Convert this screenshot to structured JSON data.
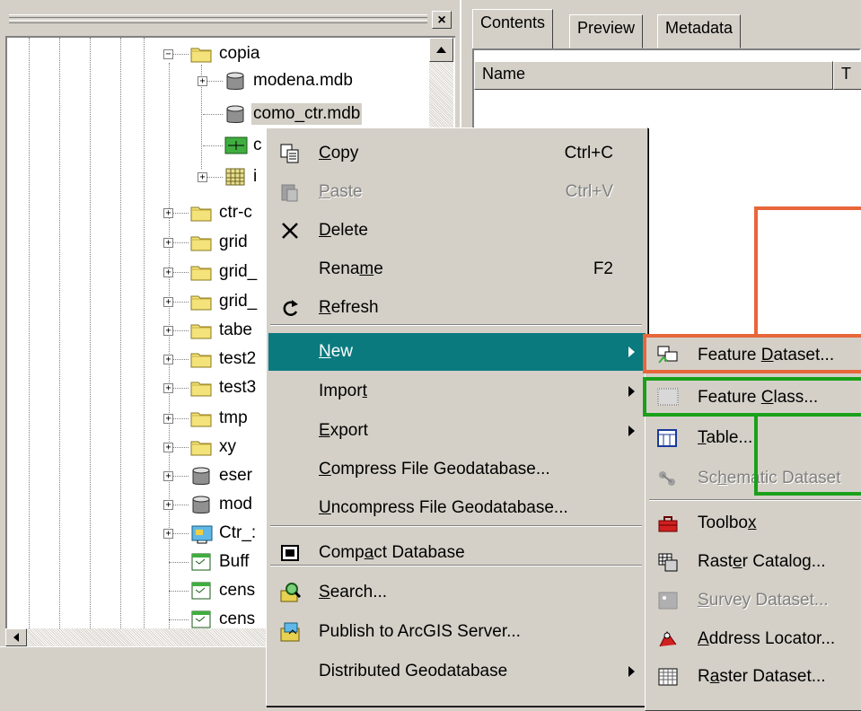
{
  "tree": {
    "items": [
      {
        "label": "copia",
        "icon": "folder-icon",
        "expander": "−"
      },
      {
        "label": "modena.mdb",
        "icon": "database-icon",
        "expander": "+"
      },
      {
        "label": "como_ctr.mdb",
        "icon": "database-icon",
        "expander": ""
      },
      {
        "label": "c",
        "icon": "feature-class-icon",
        "expander": ""
      },
      {
        "label": "i",
        "icon": "raster-icon",
        "expander": "+"
      },
      {
        "label": "ctr-c",
        "icon": "folder-icon",
        "expander": "+"
      },
      {
        "label": "grid",
        "icon": "folder-icon",
        "expander": "+"
      },
      {
        "label": "grid_",
        "icon": "folder-icon",
        "expander": "+"
      },
      {
        "label": "grid_",
        "icon": "folder-icon",
        "expander": "+"
      },
      {
        "label": "tabe",
        "icon": "folder-icon",
        "expander": "+"
      },
      {
        "label": "test2",
        "icon": "folder-icon",
        "expander": "+"
      },
      {
        "label": "test3",
        "icon": "folder-icon",
        "expander": "+"
      },
      {
        "label": "tmp",
        "icon": "folder-icon",
        "expander": "+"
      },
      {
        "label": "xy",
        "icon": "folder-icon",
        "expander": "+"
      },
      {
        "label": "eser",
        "icon": "database-icon",
        "expander": "+"
      },
      {
        "label": "mod",
        "icon": "database-icon",
        "expander": "+"
      },
      {
        "label": "Ctr_:",
        "icon": "server-icon",
        "expander": "+"
      },
      {
        "label": "Buff",
        "icon": "table-icon",
        "expander": ""
      },
      {
        "label": "cens",
        "icon": "table-icon",
        "expander": ""
      },
      {
        "label": "cens",
        "icon": "table-icon",
        "expander": ""
      }
    ]
  },
  "right": {
    "tabs": [
      "Contents",
      "Preview",
      "Metadata"
    ],
    "columns": [
      "Name",
      "T"
    ]
  },
  "context_menu": {
    "items": [
      {
        "pre": "",
        "u": "C",
        "post": "opy",
        "shortcut": "Ctrl+C",
        "icon": "copy-icon",
        "disabled": false
      },
      {
        "pre": "",
        "u": "P",
        "post": "aste",
        "shortcut": "Ctrl+V",
        "icon": "paste-icon",
        "disabled": true
      },
      {
        "pre": "",
        "u": "D",
        "post": "elete",
        "shortcut": "",
        "icon": "delete-icon",
        "disabled": false
      },
      {
        "pre": "Rena",
        "u": "m",
        "post": "e",
        "shortcut": "F2",
        "icon": "",
        "disabled": false
      },
      {
        "pre": "",
        "u": "R",
        "post": "efresh",
        "shortcut": "",
        "icon": "refresh-icon",
        "disabled": false
      },
      {
        "pre": "",
        "u": "N",
        "post": "ew",
        "shortcut": "",
        "icon": "",
        "disabled": false
      },
      {
        "pre": "Impor",
        "u": "t",
        "post": "",
        "shortcut": "",
        "icon": "",
        "disabled": false
      },
      {
        "pre": "",
        "u": "E",
        "post": "xport",
        "shortcut": "",
        "icon": "",
        "disabled": false
      },
      {
        "pre": "",
        "u": "C",
        "post": "ompress File Geodatabase...",
        "shortcut": "",
        "icon": "",
        "disabled": false
      },
      {
        "pre": "",
        "u": "U",
        "post": "ncompress File Geodatabase...",
        "shortcut": "",
        "icon": "",
        "disabled": false
      },
      {
        "pre": "Comp",
        "u": "a",
        "post": "ct Database",
        "shortcut": "",
        "icon": "compact-icon",
        "disabled": false
      },
      {
        "pre": "",
        "u": "S",
        "post": "earch...",
        "shortcut": "",
        "icon": "search-icon",
        "disabled": false
      },
      {
        "pre": "Publish to ArcGIS Server...",
        "u": "",
        "post": "",
        "shortcut": "",
        "icon": "publish-icon",
        "disabled": false
      },
      {
        "pre": "Distributed Geodatabase",
        "u": "",
        "post": "",
        "shortcut": "",
        "icon": "",
        "disabled": false
      }
    ]
  },
  "sub_menu": {
    "items": [
      {
        "pre": "Feature ",
        "u": "D",
        "post": "ataset...",
        "icon": "feature-dataset-icon",
        "disabled": false
      },
      {
        "pre": "Feature ",
        "u": "C",
        "post": "lass...",
        "icon": "feature-class-icon",
        "disabled": false
      },
      {
        "pre": "",
        "u": "T",
        "post": "able...",
        "icon": "table-icon",
        "disabled": false
      },
      {
        "pre": "Sc",
        "u": "h",
        "post": "ematic Dataset",
        "icon": "schematic-icon",
        "disabled": true
      },
      {
        "pre": "Toolbo",
        "u": "x",
        "post": "",
        "icon": "toolbox-icon",
        "disabled": false
      },
      {
        "pre": "Rast",
        "u": "e",
        "post": "r Catalog...",
        "icon": "raster-catalog-icon",
        "disabled": false
      },
      {
        "pre": "",
        "u": "S",
        "post": "urvey Dataset...",
        "icon": "survey-icon",
        "disabled": true
      },
      {
        "pre": "",
        "u": "A",
        "post": "ddress Locator...",
        "icon": "address-locator-icon",
        "disabled": false
      },
      {
        "pre": "R",
        "u": "a",
        "post": "ster Dataset...",
        "icon": "raster-dataset-icon",
        "disabled": false
      }
    ]
  },
  "colors": {
    "highlight": "#0a7a7f",
    "annotation_orange": "#e8673a",
    "annotation_green": "#1aa01a"
  }
}
